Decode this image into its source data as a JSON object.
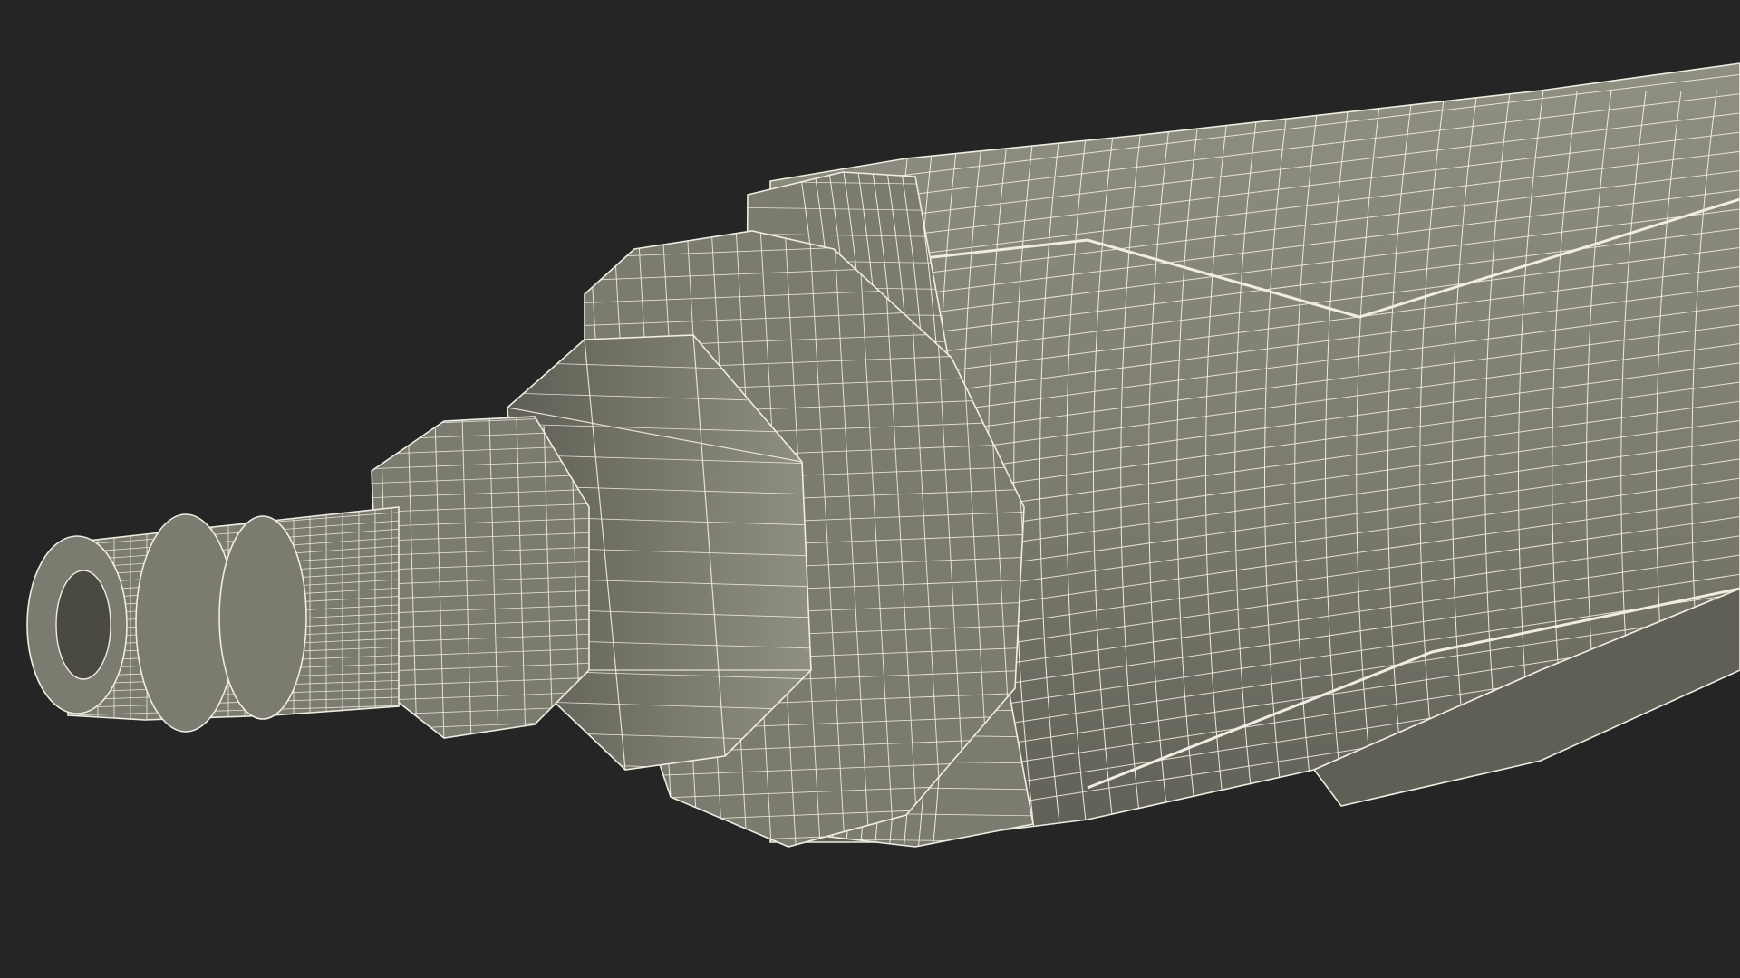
{
  "render": {
    "subject": "wireframe-render-pneumatic-tool",
    "colors": {
      "background": "#252525",
      "body": "#7b7b6f",
      "body_shadow": "#5f5f55",
      "body_highlight": "#8f8f82",
      "hex_nut": "#6f6f65",
      "wire": "#efece2",
      "bore": "#4a4a43"
    }
  }
}
